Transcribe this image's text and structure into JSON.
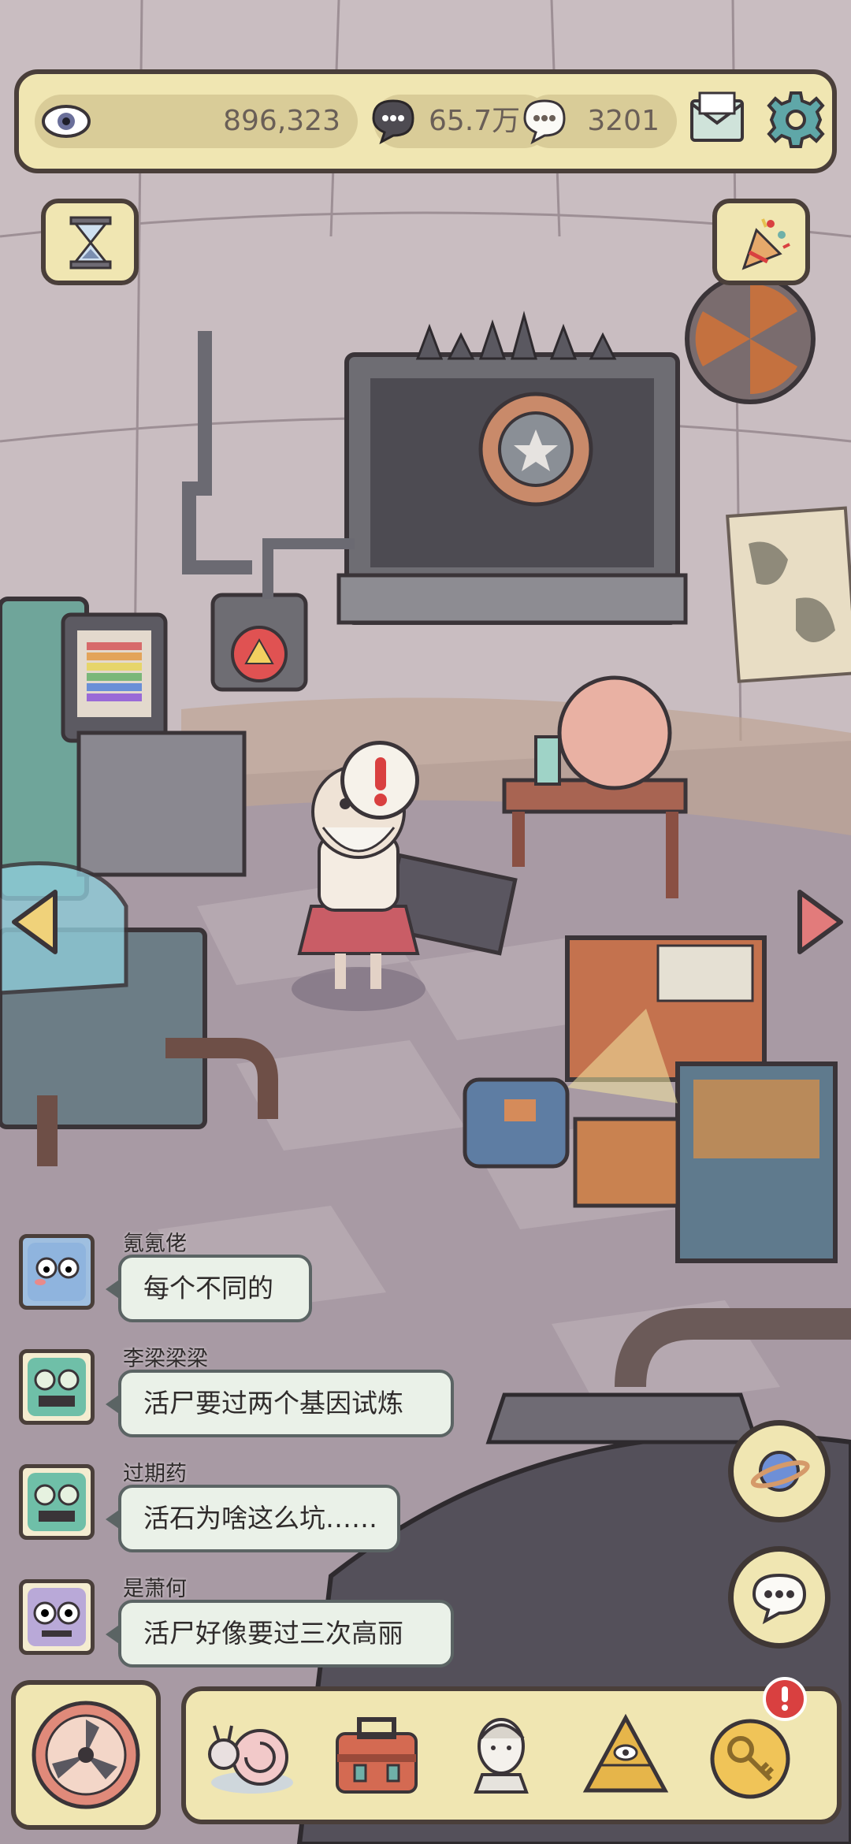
{
  "resources": {
    "eye_count": "896,323",
    "dark_bubble_count": "65.7万",
    "white_bubble_count": "3201"
  },
  "icons": {
    "eye": "eye-icon",
    "dark_bubble": "dark-speech-bubble-icon",
    "white_bubble": "white-speech-bubble-icon",
    "mail": "mail-icon",
    "settings": "gear-icon",
    "hourglass": "hourglass-icon",
    "party": "party-popper-icon",
    "alert": "exclamation-icon",
    "planet": "planet-icon",
    "chat": "chat-icon",
    "nav": [
      "snail-icon",
      "toolbox-icon",
      "bust-statue-icon",
      "pyramid-eye-icon",
      "key-coin-icon"
    ]
  },
  "chat": [
    {
      "name": "氪氪佬",
      "message": "每个不同的"
    },
    {
      "name": "李梁梁梁",
      "message": "活尸要过两个基因试炼"
    },
    {
      "name": "过期药",
      "message": "活石为啥这么坑……"
    },
    {
      "name": "是萧何",
      "message": "活尸好像要过三次高丽"
    }
  ],
  "colors": {
    "panel": "#f0e6b2",
    "outline": "#4a3f3a",
    "alert_red": "#d94040",
    "bubble_bg": "#eaf1e8"
  }
}
